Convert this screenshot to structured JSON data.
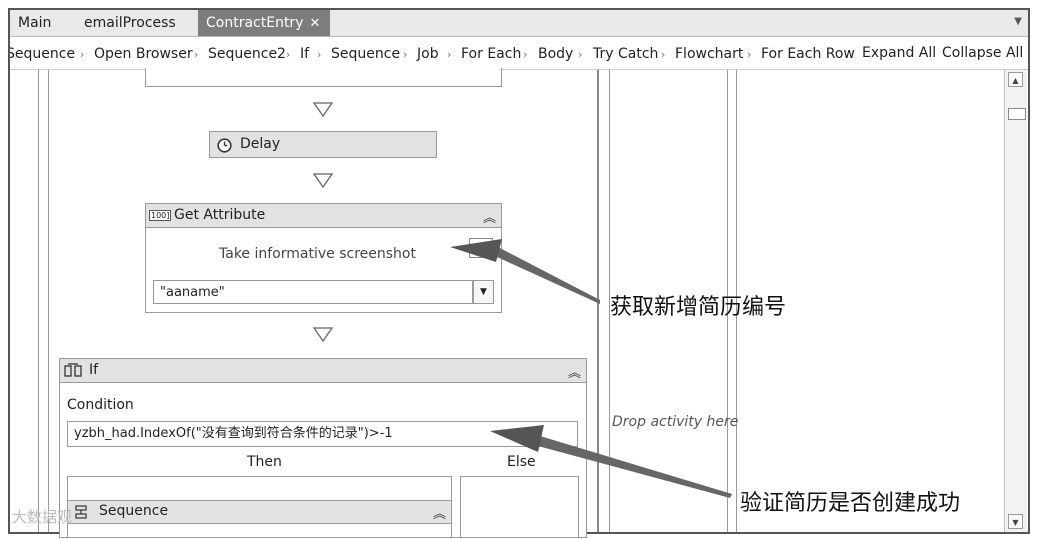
{
  "tabs": [
    {
      "label": "Main",
      "active": false
    },
    {
      "label": "emailProcess",
      "active": false
    },
    {
      "label": "ContractEntry",
      "active": true,
      "close": "✕"
    }
  ],
  "breadcrumb": {
    "items": [
      "Sequence",
      "Open Browser",
      "Sequence2",
      "If",
      "Sequence",
      "Job",
      "For Each",
      "Body",
      "Try Catch",
      "Flowchart",
      "For Each Row"
    ],
    "separator": "›",
    "expand_label": "Expand All",
    "collapse_label": "Collapse All"
  },
  "activities": {
    "delay": {
      "title": "Delay",
      "icon": "clock-icon"
    },
    "get_attribute": {
      "title": "Get Attribute",
      "icon": "get-attribute-icon",
      "icon_text": "100]",
      "body_text": "Take informative screenshot",
      "selector_value": "\"aaname\""
    },
    "if": {
      "title": "If",
      "icon": "if-icon",
      "condition_label": "Condition",
      "condition_value": "yzbh_had.IndexOf(\"没有查询到符合条件的记录\")>-1",
      "then_label": "Then",
      "else_label": "Else",
      "sequence_title": "Sequence"
    },
    "drop_hint": "Drop activity here"
  },
  "annotations": {
    "get_number": "获取新增简历编号",
    "verify": "验证简历是否创建成功"
  },
  "watermark": "大数据观"
}
